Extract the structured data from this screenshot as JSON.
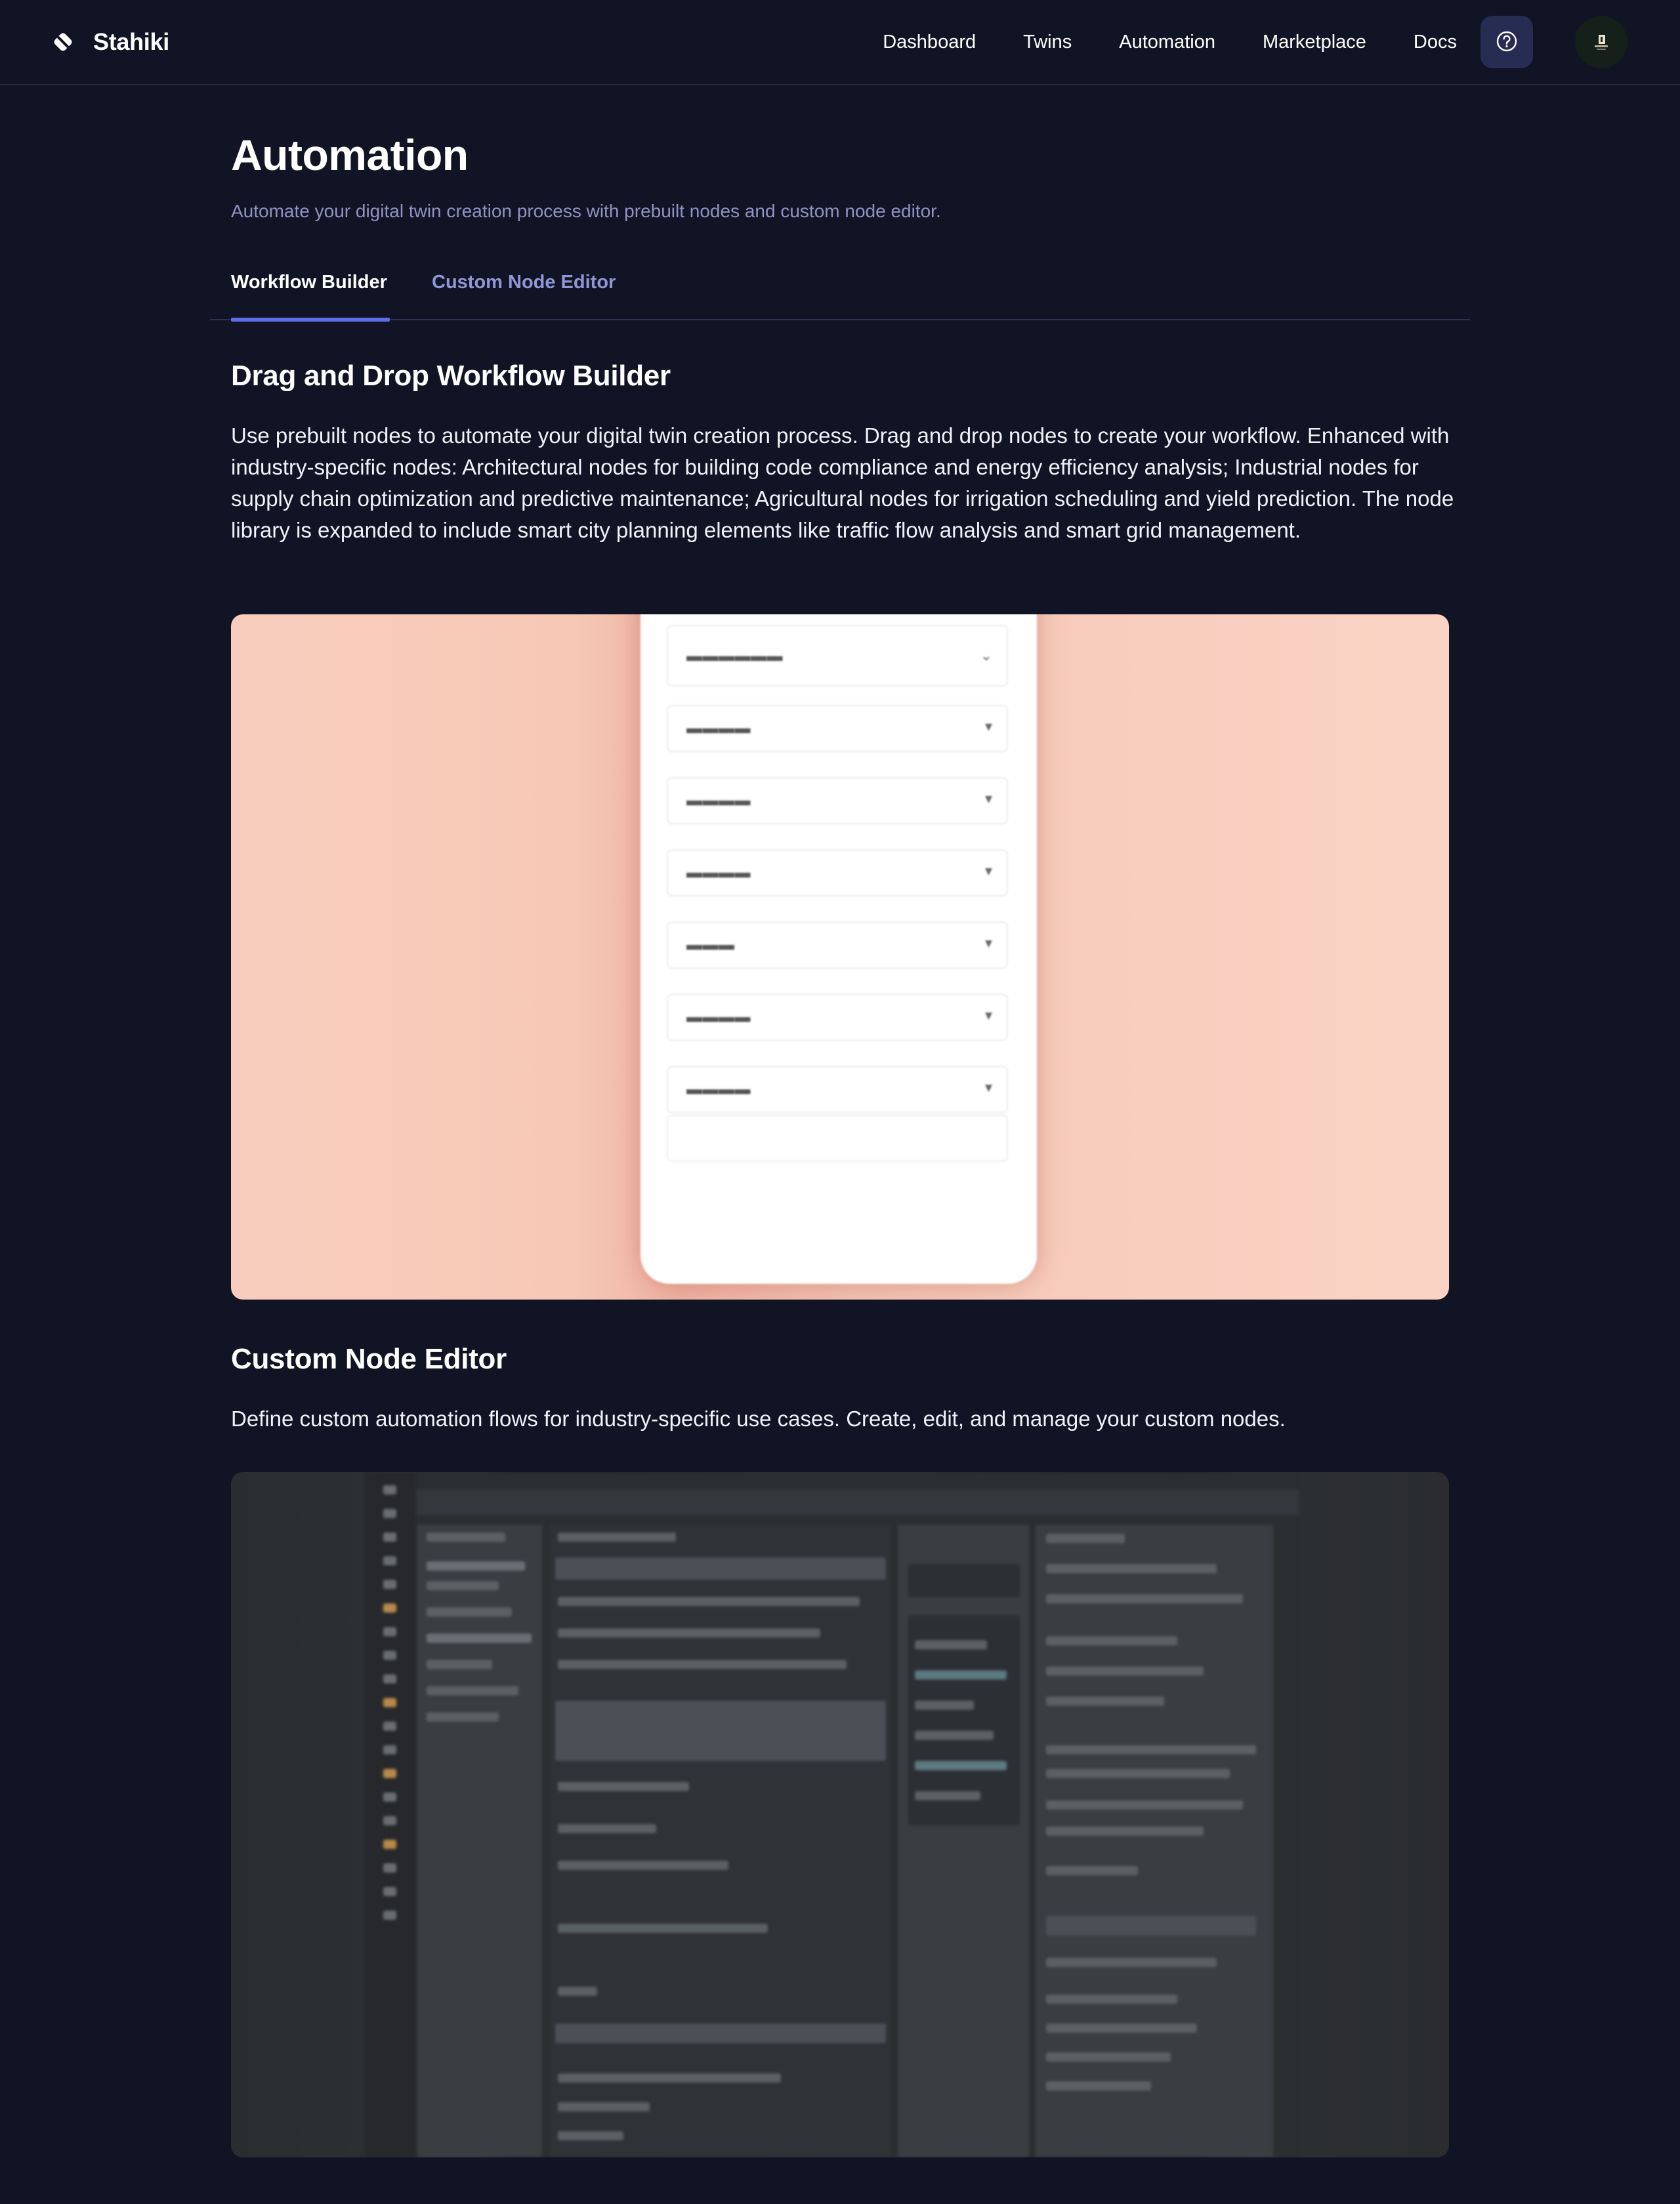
{
  "brand": {
    "name": "Stahiki"
  },
  "nav": {
    "items": [
      {
        "label": "Dashboard"
      },
      {
        "label": "Twins"
      },
      {
        "label": "Automation"
      },
      {
        "label": "Marketplace"
      },
      {
        "label": "Docs"
      }
    ]
  },
  "page": {
    "title": "Automation",
    "subtitle": "Automate your digital twin creation process with prebuilt nodes and custom node editor."
  },
  "tabs": [
    {
      "label": "Workflow Builder",
      "active": true
    },
    {
      "label": "Custom Node Editor",
      "active": false
    }
  ],
  "sections": {
    "workflow": {
      "title": "Drag and Drop Workflow Builder",
      "body": "Use prebuilt nodes to automate your digital twin creation process. Drag and drop nodes to create your workflow. Enhanced with industry-specific nodes: Architectural nodes for building code compliance and energy efficiency analysis; Industrial nodes for supply chain optimization and predictive maintenance; Agricultural nodes for irrigation scheduling and yield prediction. The node library is expanded to include smart city planning elements like traffic flow analysis and smart grid management."
    },
    "custom_editor": {
      "title": "Custom Node Editor",
      "body": "Define custom automation flows for industry-specific use cases. Create, edit, and manage your custom nodes."
    }
  },
  "colors": {
    "background": "#111425",
    "accent": "#5d6ee6",
    "subtitle": "#8f94c2",
    "inactive_tab": "#8f97d4",
    "help_button_bg": "#262c52"
  },
  "icons": {
    "brand": "diamond-logo-icon",
    "help": "question-circle-icon",
    "avatar": "user-avatar"
  }
}
